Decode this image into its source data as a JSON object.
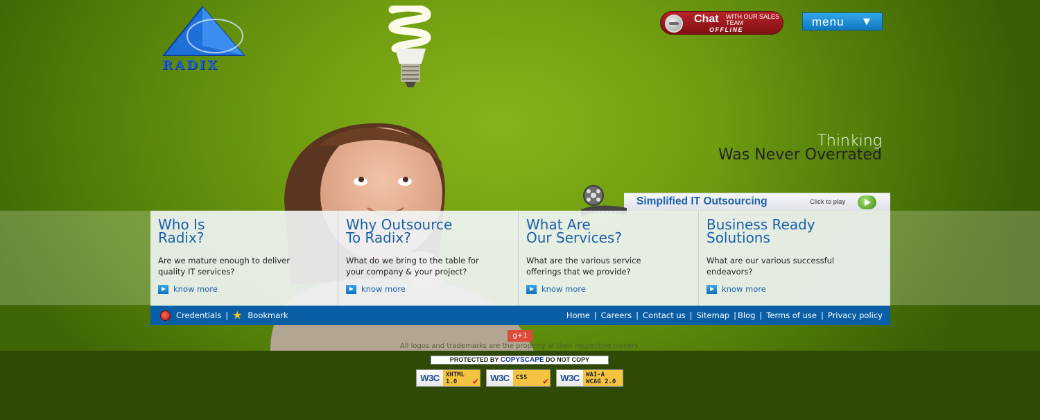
{
  "logo": {
    "text": "RADIX"
  },
  "chat": {
    "title": "Chat",
    "subtitle": "With our Sales Team",
    "status": "OFFLINE"
  },
  "menu": {
    "label": "menu",
    "caret": "▼"
  },
  "tagline": {
    "line1": "Thinking",
    "line2": "Was Never Overrated"
  },
  "video": {
    "title": "Simplified IT Outsourcing",
    "play_text": "Click to play"
  },
  "panels": [
    {
      "title": "Who Is\nRadix?",
      "desc_line1": "Are we mature enough to deliver",
      "desc_line2": "quality IT services?",
      "link": "know more"
    },
    {
      "title": "Why Outsource\nTo Radix?",
      "desc_line1": "What do we bring to the table for",
      "desc_line2": "your company & your project?",
      "link": "know more"
    },
    {
      "title": "What Are\nOur Services?",
      "desc_line1": "What are the various service",
      "desc_line2": "offerings that we provide?",
      "link": "know more"
    },
    {
      "title": "Business Ready\nSolutions",
      "desc_line1": "What are our various successful",
      "desc_line2": "endeavors?",
      "link": "know more"
    }
  ],
  "footer_nav": {
    "credentials": "Credentials",
    "left_sep": "|",
    "bookmark": "Bookmark",
    "links": [
      "Home",
      "Careers",
      "Contact us",
      "Sitemap",
      "Blog",
      "Terms of use",
      "Privacy policy"
    ]
  },
  "gplus": {
    "label": "g+1"
  },
  "copyright": "All logos and trademarks are the property of their respective owners",
  "copyscape": {
    "prefix": "PROTECTED BY",
    "brand": "COPYSCAPE",
    "suffix": "DO NOT COPY"
  },
  "badges": [
    {
      "org": "W3C",
      "spec_line1": "XHTML",
      "spec_line2": "1.0"
    },
    {
      "org": "W3C",
      "spec_line1": "CSS",
      "spec_line2": ""
    },
    {
      "org": "W3C",
      "spec_line1": "WAI-A",
      "spec_line2": "WCAG 2.0"
    }
  ],
  "colors": {
    "brand_blue": "#1a5fa8",
    "nav_blue": "#0a5ea5",
    "hero_green": "#6f9c10",
    "footer_green": "#2f4a06",
    "chat_red": "#b8232a"
  },
  "icons": {
    "chat": "offline-indicator-icon",
    "video": "film-reel-icon",
    "play": "play-icon",
    "know_more": "arrow-right-icon",
    "credentials": "seal-icon",
    "bookmark": "star-icon"
  }
}
